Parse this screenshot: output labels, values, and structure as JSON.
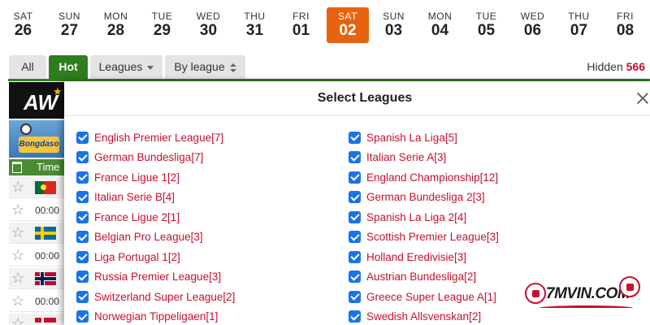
{
  "dates": [
    {
      "dow": "SAT",
      "num": "26",
      "active": false
    },
    {
      "dow": "SUN",
      "num": "27",
      "active": false
    },
    {
      "dow": "MON",
      "num": "28",
      "active": false
    },
    {
      "dow": "TUE",
      "num": "29",
      "active": false
    },
    {
      "dow": "WED",
      "num": "30",
      "active": false
    },
    {
      "dow": "THU",
      "num": "31",
      "active": false
    },
    {
      "dow": "FRI",
      "num": "01",
      "active": false
    },
    {
      "dow": "SAT",
      "num": "02",
      "active": true
    },
    {
      "dow": "SUN",
      "num": "03",
      "active": false
    },
    {
      "dow": "MON",
      "num": "04",
      "active": false
    },
    {
      "dow": "TUE",
      "num": "05",
      "active": false
    },
    {
      "dow": "WED",
      "num": "06",
      "active": false
    },
    {
      "dow": "THU",
      "num": "07",
      "active": false
    },
    {
      "dow": "FRI",
      "num": "08",
      "active": false
    }
  ],
  "filters": {
    "all_label": "All",
    "hot_label": "Hot",
    "leagues_label": "Leagues",
    "by_league_label": "By league",
    "hidden_label": "Hidden",
    "hidden_count": "566"
  },
  "list": {
    "banner_text": "AW",
    "logo_text": "Bongdaso",
    "time_header": "Time",
    "rows": [
      {
        "flag": "pt",
        "time": ""
      },
      {
        "flag": "",
        "time": "00:00"
      },
      {
        "flag": "se",
        "time": ""
      },
      {
        "flag": "",
        "time": "00:00"
      },
      {
        "flag": "no",
        "time": ""
      },
      {
        "flag": "",
        "time": "00:00"
      },
      {
        "flag": "dk",
        "time": ""
      }
    ]
  },
  "modal": {
    "title": "Select Leagues",
    "left_leagues": [
      "English Premier League[7]",
      "German Bundesliga[7]",
      "France Ligue 1[2]",
      "Italian Serie B[4]",
      "France Ligue 2[1]",
      "Belgian Pro League[3]",
      "Liga Portugal 1[2]",
      "Russia Premier League[3]",
      "Switzerland Super League[2]",
      "Norwegian Tippeligaen[1]"
    ],
    "right_leagues": [
      "Spanish La Liga[5]",
      "Italian Serie A[3]",
      "England Championship[12]",
      "German Bundesliga 2[3]",
      "Spanish La Liga 2[4]",
      "Scottish Premier League[3]",
      "Holland Eredivisie[3]",
      "Austrian Bundesliga[2]",
      "Greece Super League A[1]",
      "Swedish Allsvenskan[2]"
    ]
  },
  "watermark": {
    "text": "7MVIN.COM"
  },
  "colors": {
    "accent": "#e8630f",
    "hot": "#2f7d1f",
    "league_text": "#c8102e",
    "checkbox": "#1a73e8"
  }
}
